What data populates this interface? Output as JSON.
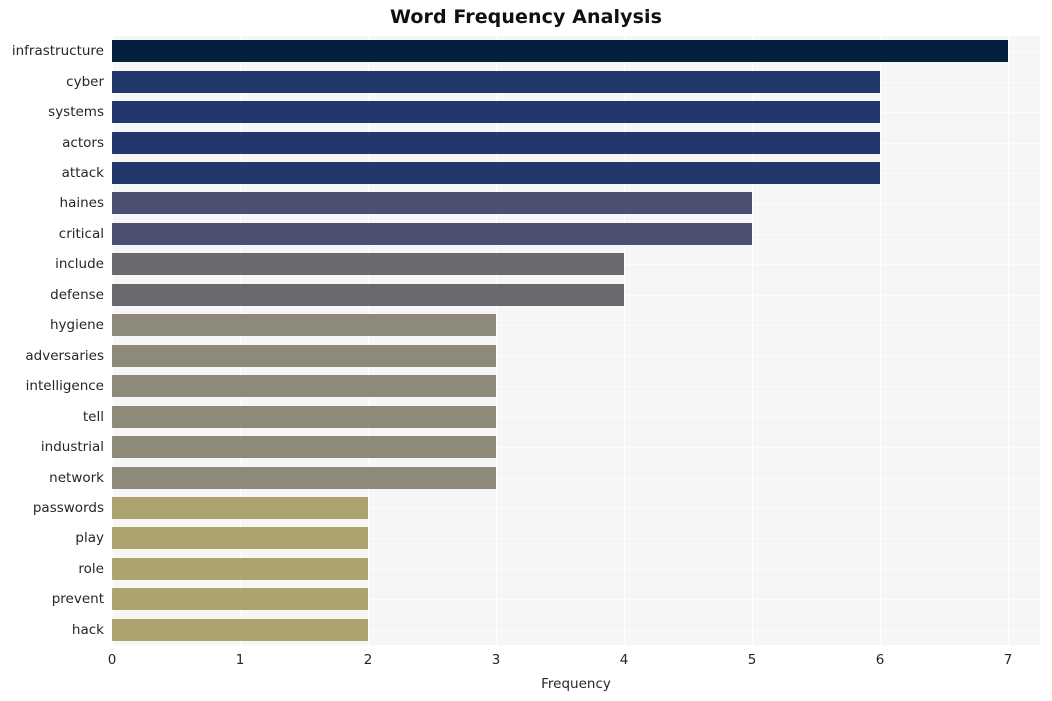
{
  "chart_data": {
    "type": "bar",
    "orientation": "horizontal",
    "title": "Word Frequency Analysis",
    "xlabel": "Frequency",
    "ylabel": "",
    "xlim": [
      0,
      7.25
    ],
    "xticks": [
      0,
      1,
      2,
      3,
      4,
      5,
      6,
      7
    ],
    "xtick_labels": [
      "0",
      "1",
      "2",
      "3",
      "4",
      "5",
      "6",
      "7"
    ],
    "grid": true,
    "grid_axis": "both",
    "legend": "none",
    "plot_background": "#f6f6f7",
    "figure_background": "#ffffff",
    "categories": [
      "infrastructure",
      "cyber",
      "systems",
      "actors",
      "attack",
      "haines",
      "critical",
      "include",
      "defense",
      "hygiene",
      "adversaries",
      "intelligence",
      "tell",
      "industrial",
      "network",
      "passwords",
      "play",
      "role",
      "prevent",
      "hack"
    ],
    "values": [
      7,
      6,
      6,
      6,
      6,
      5,
      5,
      4,
      4,
      3,
      3,
      3,
      3,
      3,
      3,
      2,
      2,
      2,
      2,
      2
    ],
    "bar_colors": [
      "#04203f",
      "#22376c",
      "#22376c",
      "#22376c",
      "#22376c",
      "#4b5071",
      "#4b5071",
      "#6a6a6e",
      "#6a6a6e",
      "#8e8a7a",
      "#8e8a7a",
      "#8e8a7a",
      "#8e8a7a",
      "#8e8a7a",
      "#8e8a7a",
      "#aca46e",
      "#aca46e",
      "#aca46e",
      "#aca46e",
      "#aca46e"
    ]
  }
}
